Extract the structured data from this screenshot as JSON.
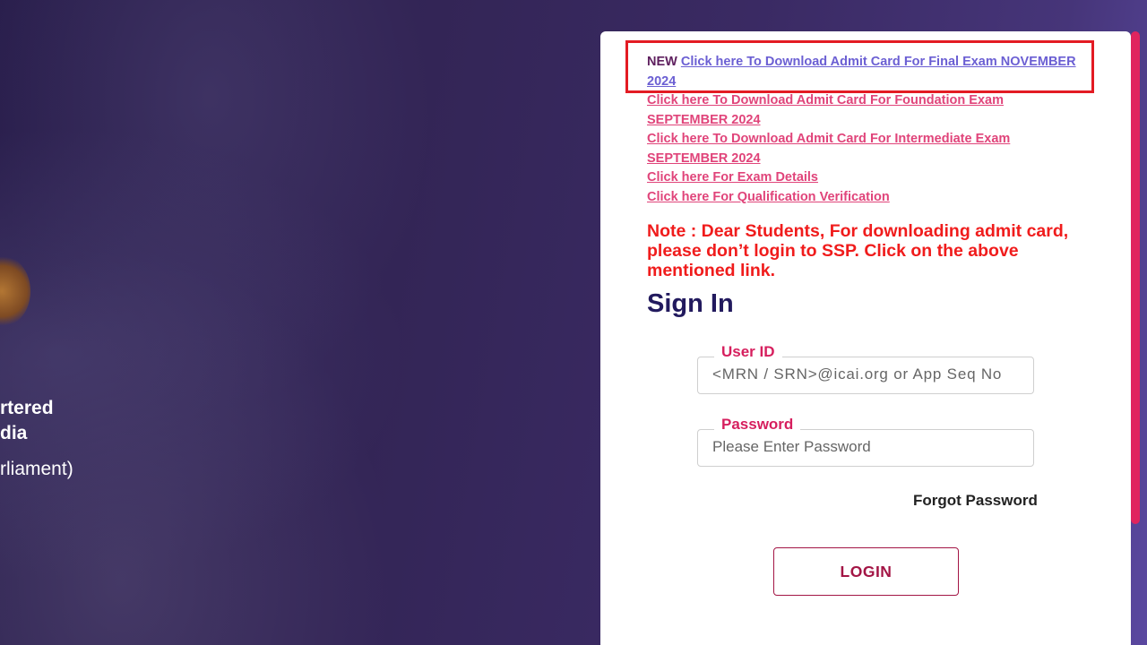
{
  "background": {
    "institute_name_lines": [
      "rtered",
      "dia"
    ],
    "institute_sub": "rliament)"
  },
  "links": {
    "new_tag": "NEW",
    "items": [
      "Click here To Download Admit Card For Final Exam NOVEMBER 2024",
      "Click here To Download Admit Card For Foundation Exam SEPTEMBER 2024",
      "Click here To Download Admit Card For Intermediate Exam SEPTEMBER 2024",
      "Click here For Exam Details",
      "Click here For Qualification Verification"
    ]
  },
  "note": "Note : Dear Students, For downloading admit card, please don’t login to SSP. Click on the above mentioned link.",
  "signin": {
    "title": "Sign In",
    "user_id_label": "User ID",
    "user_id_placeholder": "<MRN / SRN>@icai.org or App Seq No",
    "password_label": "Password",
    "password_placeholder": "Please Enter Password",
    "forgot_label": "Forgot Password",
    "login_label": "LOGIN"
  },
  "colors": {
    "accent": "#d61f5e",
    "note_red": "#f01c1c",
    "highlight_border": "#e31b23",
    "title_navy": "#221a5e",
    "primary_link": "#6b5fd3",
    "secondary_link": "#e0447a"
  }
}
